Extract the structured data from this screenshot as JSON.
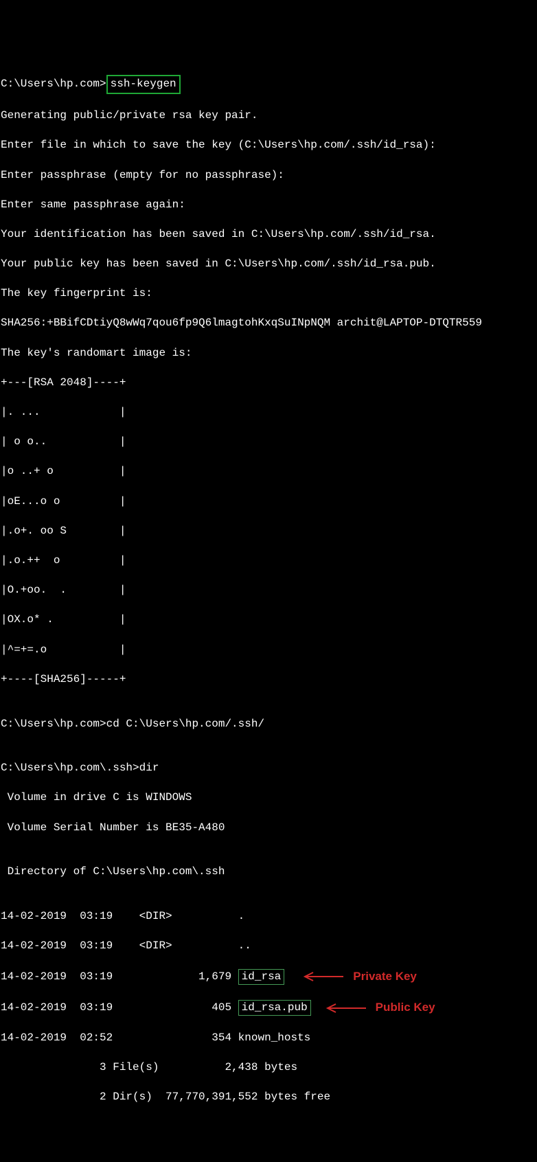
{
  "prompt1_prefix": "C:\\Users\\hp.com>",
  "command1": "ssh-keygen",
  "out": [
    "Generating public/private rsa key pair.",
    "Enter file in which to save the key (C:\\Users\\hp.com/.ssh/id_rsa):",
    "Enter passphrase (empty for no passphrase):",
    "Enter same passphrase again:",
    "Your identification has been saved in C:\\Users\\hp.com/.ssh/id_rsa.",
    "Your public key has been saved in C:\\Users\\hp.com/.ssh/id_rsa.pub.",
    "The key fingerprint is:",
    "SHA256:+BBifCDtiyQ8wWq7qou6fp9Q6lmagtohKxqSuINpNQM archit@LAPTOP-DTQTR559",
    "The key's randomart image is:"
  ],
  "art": [
    "+---[RSA 2048]----+",
    "|. ...            |",
    "| o o..           |",
    "|o ..+ o          |",
    "|oE...o o         |",
    "|.o+. oo S        |",
    "|.o.++  o         |",
    "|O.+oo.  .        |",
    "|OX.o* .          |",
    "|^=+=.o           |",
    "+----[SHA256]-----+"
  ],
  "blank": "",
  "prompt2": "C:\\Users\\hp.com>cd C:\\Users\\hp.com/.ssh/",
  "prompt3": "C:\\Users\\hp.com\\.ssh>dir",
  "vol1": " Volume in drive C is WINDOWS",
  "vol2": " Volume Serial Number is BE35-A480",
  "dirof": " Directory of C:\\Users\\hp.com\\.ssh",
  "row_dir1": "14-02-2019  03:19    <DIR>          .",
  "row_dir2": "14-02-2019  03:19    <DIR>          ..",
  "row_priv_pre": "14-02-2019  03:19             1,679 ",
  "row_priv_file": "id_rsa",
  "row_pub_pre": "14-02-2019  03:19               405 ",
  "row_pub_file": "id_rsa.pub",
  "row_known": "14-02-2019  02:52               354 known_hosts",
  "sum1": "               3 File(s)          2,438 bytes",
  "sum2": "               2 Dir(s)  77,770,391,552 bytes free",
  "label_priv": "Private Key",
  "label_pub": "Public Key"
}
